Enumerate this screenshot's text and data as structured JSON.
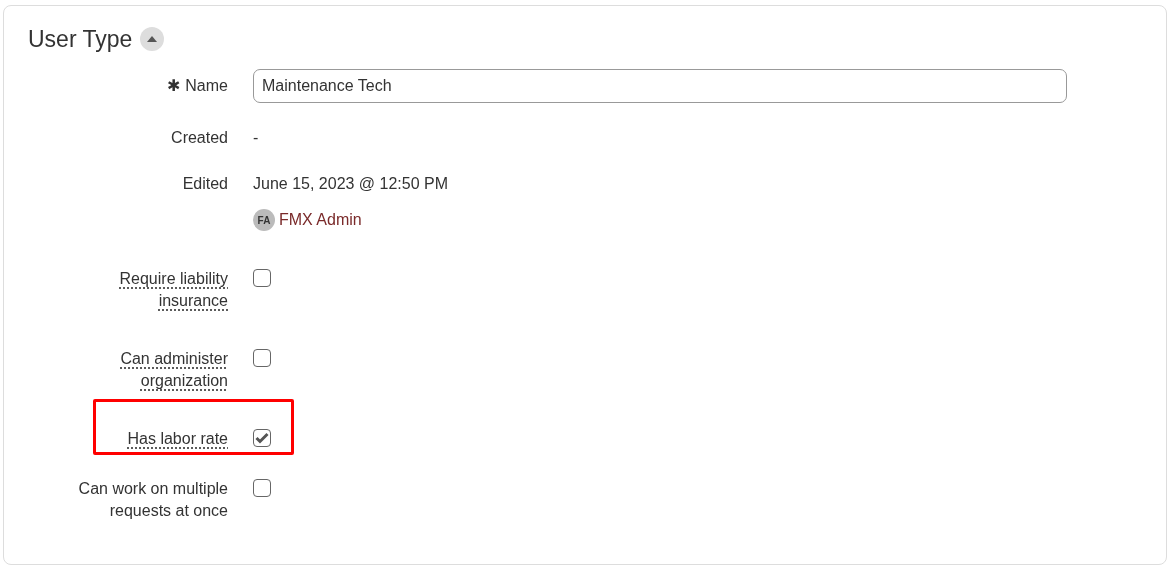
{
  "section": {
    "title": "User Type",
    "expanded": true
  },
  "fields": [
    {
      "kind": "text_input",
      "label": "Name",
      "required": true,
      "required_mark": "✱",
      "value": "Maintenance Tech"
    },
    {
      "kind": "static",
      "label": "Created",
      "value": "-"
    },
    {
      "kind": "edited",
      "label": "Edited",
      "value": "June 15, 2023 @ 12:50 PM",
      "user": {
        "initials": "FA",
        "name": "FMX Admin"
      }
    },
    {
      "kind": "checkbox",
      "label": "Require liability insurance",
      "underlined": true,
      "checked": false,
      "highlighted": false
    },
    {
      "kind": "checkbox",
      "label": "Can administer organization",
      "underlined": true,
      "checked": false,
      "highlighted": false
    },
    {
      "kind": "checkbox",
      "label": "Has labor rate",
      "underlined": true,
      "checked": true,
      "highlighted": true
    },
    {
      "kind": "checkbox",
      "label": "Can work on multiple requests at once",
      "underlined": false,
      "checked": false,
      "highlighted": false
    }
  ]
}
